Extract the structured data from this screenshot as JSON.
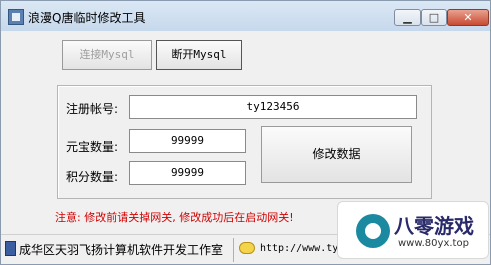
{
  "window": {
    "title": "浪漫Q唐临时修改工具",
    "controls": {
      "minimize": "▁",
      "maximize": "□",
      "close": "✕"
    }
  },
  "toolbar": {
    "connect_label": "连接Mysql",
    "disconnect_label": "断开Mysql"
  },
  "form": {
    "username_label": "注册帐号:",
    "username_value": "ty123456",
    "yuanbao_label": "元宝数量:",
    "yuanbao_value": "99999",
    "jifen_label": "积分数量:",
    "jifen_value": "99999",
    "submit_label": "修改数据"
  },
  "notice": "注意: 修改前请关掉网关, 修改成功后在启动网关!",
  "statusbar": {
    "text": "成华区天羽飞扬计算机软件开发工作室",
    "link": "http://www.tyfy.com"
  },
  "watermark": {
    "brand": "八零游戏",
    "url": "www.80yx.top"
  },
  "icons": {
    "app": "app-icon",
    "status": "computer-icon",
    "link": "chat-icon"
  }
}
